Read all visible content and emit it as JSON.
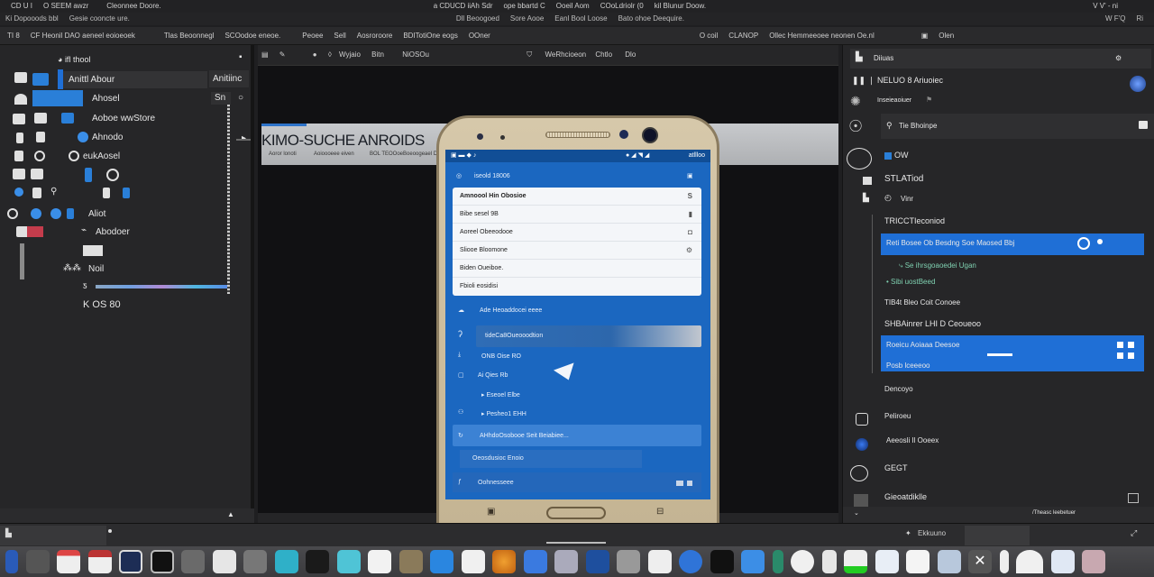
{
  "menubar1": {
    "left": [
      "CD U I",
      "O SEEM awzr",
      "Cleonnee Doore."
    ],
    "right": [
      "a CDUCD iiAh Sdr",
      "ope bbartd C",
      "Ooeil Aom",
      "COoLdriolr (0",
      "kil Blunur Doow."
    ],
    "far_right": "V V' - ni"
  },
  "menubar2": {
    "left": [
      "Ki Dopooods bbl",
      "Gesie cooncte ure."
    ],
    "right": [
      "Dll Beoogoed",
      "Sore Aooe",
      "Eanl Bool Loose",
      "Bato ohoe Deequire."
    ],
    "far_right": [
      "W F'Q",
      "Ri"
    ]
  },
  "toolbar": {
    "items": [
      "TI 8",
      "CF Heonil DAO aeneel eoioeoek",
      "Tlas Beoonnegl",
      "SCOodoe eneoe.",
      "Peoee",
      "Sell",
      "Aosroroore",
      "BDITotiOne eogs",
      "OOner"
    ],
    "right_items": [
      "O coil",
      "CLANOP",
      "Ollec Hemmeeoee neonen Oe.nl"
    ],
    "right_file": "Olen"
  },
  "left_panel": {
    "header": "ifl thool",
    "rows": [
      {
        "label": "Anittl Abour",
        "extra": "Anitiinc"
      },
      {
        "label": "Ahosel",
        "extra": "Sn"
      },
      {
        "label": "Aoboe wwStore"
      },
      {
        "label": "Ahnodo"
      },
      {
        "label": "eukAosel"
      },
      {
        "label": "Aliot"
      },
      {
        "label": "Abodoer"
      },
      {
        "label": "Noil"
      },
      {
        "label": "K OS 80"
      }
    ]
  },
  "center": {
    "toolbar_items": [
      "Wyjaio",
      "Bitn",
      "NiOSOu",
      "WeRhcioeon",
      "Chtlo",
      "Dlo"
    ],
    "banner": {
      "title": "KIMO-SUCHE ANROIDS",
      "subs": [
        "Aoror lonoti",
        "Aoioooeee eiven",
        "BOL TEOOoeBoeoogeael DIO"
      ]
    }
  },
  "phone": {
    "status_right": "atllloo",
    "app_title": "iseold 18006",
    "card_rows": [
      {
        "label": "Amnoool Hin Obosioe",
        "icon": "S"
      },
      {
        "label": "Bibe sesel 9B"
      },
      {
        "label": "Aoreel Obeeodooe"
      },
      {
        "label": "Sliooe Bloomone"
      },
      {
        "label": "Biden Oueiboe."
      },
      {
        "label": "Fbioli eosidisi"
      }
    ],
    "row_after_card": "Ade Heoaddocei eeee",
    "input_value": "tideCa8Oueooodtion",
    "list": [
      "ONB Oise RO",
      "Ai Qies Rb",
      "Eseoel Elbe",
      "Pesheo1 EHH"
    ],
    "highlight_row": "AHhdoOsobooe Seit Beiabiee...",
    "sub_row": "Oeosdusioc Enoio",
    "bottom_row": "Oohnesseee"
  },
  "right_panel": {
    "header": "Diiuas",
    "section_title": "NELUO 8 Ariuoiec",
    "section_sub": "Inseieaoiuer",
    "search_placeholder": "Tie Bhoinpe",
    "items": [
      {
        "label": "OW",
        "type": "checkbox"
      },
      {
        "label": "STLATiod"
      },
      {
        "label": "Vinr"
      },
      {
        "label": "TRICCTIeconiod"
      },
      {
        "label": "Reti Bosee Ob Besdng Soe Maosed Bbj",
        "selected": true
      },
      {
        "label": "Se ihrsgoaoedei Ugan",
        "sub": true
      },
      {
        "label": "Sibi uostBeed",
        "sub": true
      },
      {
        "label": "TIB4t Bleo Coit Conoee"
      },
      {
        "label": "SHBAinrer LHI D Ceoueoo"
      },
      {
        "label": "Roeicu Aoiaaa Deesoe",
        "label2": "Posb lceeeoo",
        "selected": true
      },
      {
        "label": "Dencoyo"
      },
      {
        "label": "Peliroeu"
      },
      {
        "label": "Aeeosli Il Ooeex"
      },
      {
        "label": "GEGT"
      },
      {
        "label": "Gieoatdiklle"
      }
    ],
    "footer": "/Theasc leebetuer"
  },
  "statusbar": {
    "right_label": "Ekkuuno"
  },
  "colors": {
    "accent": "#1f6fd6",
    "phone_screen": "#1b67c0",
    "bg": "#1f1f21"
  }
}
